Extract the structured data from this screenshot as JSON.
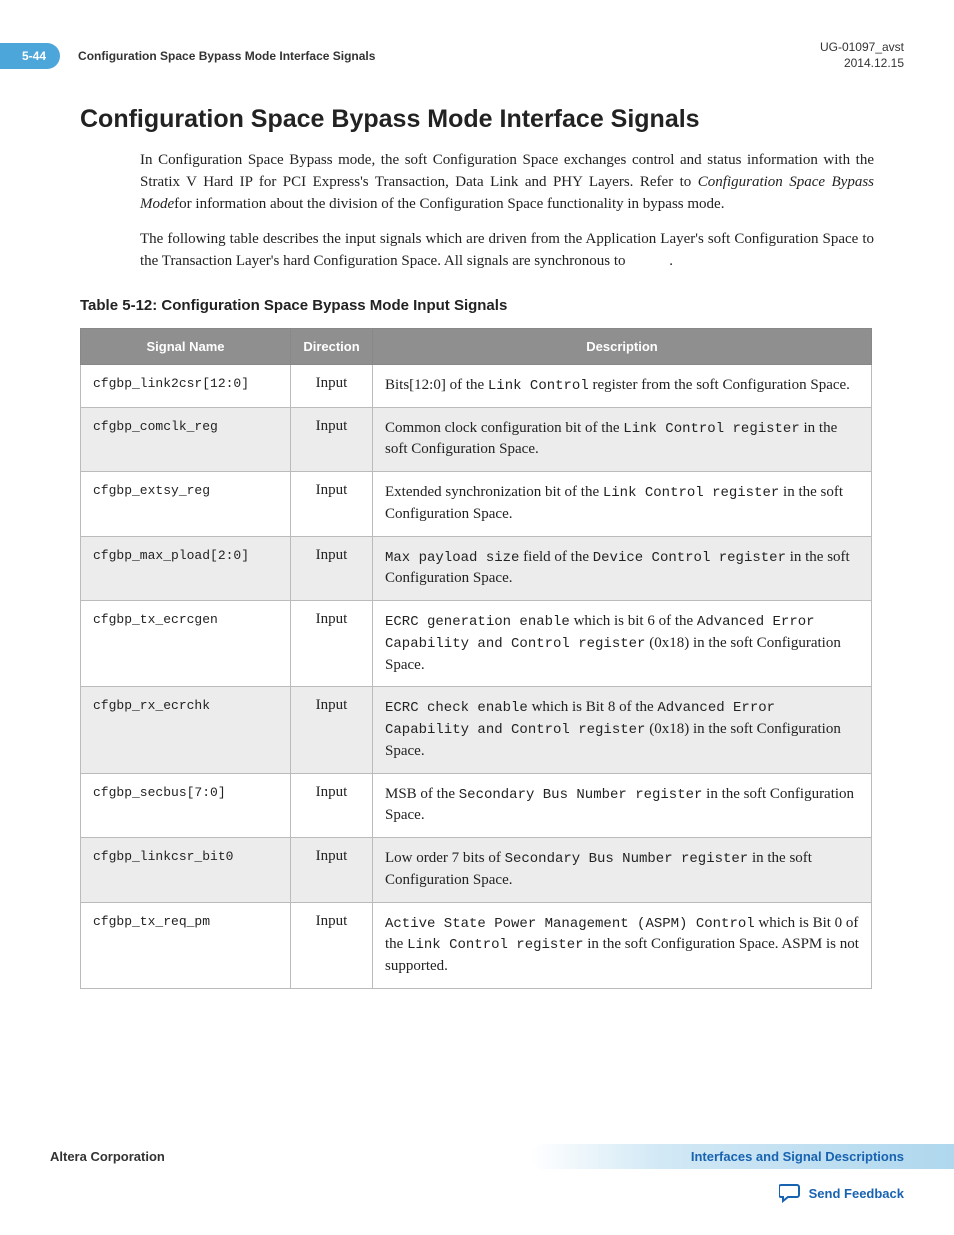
{
  "header": {
    "page_number": "5-44",
    "running_title": "Configuration Space Bypass Mode Interface Signals",
    "doc_id": "UG-01097_avst",
    "doc_date": "2014.12.15"
  },
  "section": {
    "title": "Configuration Space Bypass Mode Interface Signals",
    "para1_a": "In Configuration Space Bypass mode, the soft Configuration Space exchanges control and status information with the Stratix V Hard IP for PCI Express's Transaction, Data Link and PHY Layers. Refer to ",
    "para1_ital": "Configuration Space Bypass Mode",
    "para1_b": "for information about the division of the Configuration Space functionality in bypass mode.",
    "para2_a": "The following table describes the input signals which are driven from the Application Layer's soft Configuration Space to the Transaction Layer's hard Configuration Space. All signals are synchronous to ",
    "para2_sig": "    ",
    "para2_b": "."
  },
  "table": {
    "caption": "Table 5-12: Configuration Space Bypass Mode Input Signals",
    "headers": {
      "name": "Signal Name",
      "dir": "Direction",
      "desc": "Description"
    },
    "rows": [
      {
        "name": "cfgbp_link2csr[12:0]",
        "dir": "Input",
        "desc_parts": [
          "Bits[12:0] of the ",
          "Link Control",
          " register from the soft Configuration Space."
        ]
      },
      {
        "name": "cfgbp_comclk_reg",
        "dir": "Input",
        "desc_parts": [
          "Common clock configuration bit of the ",
          "Link Control register",
          " in the soft Configuration Space."
        ]
      },
      {
        "name": "cfgbp_extsy_reg",
        "dir": "Input",
        "desc_parts": [
          "Extended synchronization bit of the ",
          "Link Control register",
          " in the soft Configuration Space."
        ]
      },
      {
        "name": "cfgbp_max_pload[2:0]",
        "dir": "Input",
        "desc_parts": [
          "Max payload size",
          " field of the ",
          "Device Control register",
          " in the soft Configuration Space."
        ]
      },
      {
        "name": "cfgbp_tx_ecrcgen",
        "dir": "Input",
        "desc_parts": [
          "ECRC generation enable",
          " which is bit 6 of the ",
          "Advanced Error Capability and Control register",
          " (0x18) in the soft Configuration Space."
        ]
      },
      {
        "name": "cfgbp_rx_ecrchk",
        "dir": "Input",
        "desc_parts": [
          "ECRC check enable",
          " which is Bit 8 of the ",
          "Advanced Error Capability and Control register",
          " (0x18) in the soft Configuration Space."
        ]
      },
      {
        "name": "cfgbp_secbus[7:0]",
        "dir": "Input",
        "desc_parts": [
          "MSB of the ",
          "Secondary Bus Number register",
          " in the soft Configuration Space."
        ]
      },
      {
        "name": "cfgbp_linkcsr_bit0",
        "dir": "Input",
        "desc_parts": [
          "Low order 7 bits of ",
          "Secondary Bus Number register",
          " in the soft Configuration Space."
        ]
      },
      {
        "name": "cfgbp_tx_req_pm",
        "dir": "Input",
        "desc_parts": [
          "Active State Power Management (ASPM) Control",
          " which is Bit 0 of the ",
          "Link Control register",
          " in the soft Configuration Space. ASPM is not supported."
        ]
      }
    ]
  },
  "footer": {
    "company": "Altera Corporation",
    "doc_link": "Interfaces and Signal Descriptions",
    "feedback": "Send Feedback"
  }
}
